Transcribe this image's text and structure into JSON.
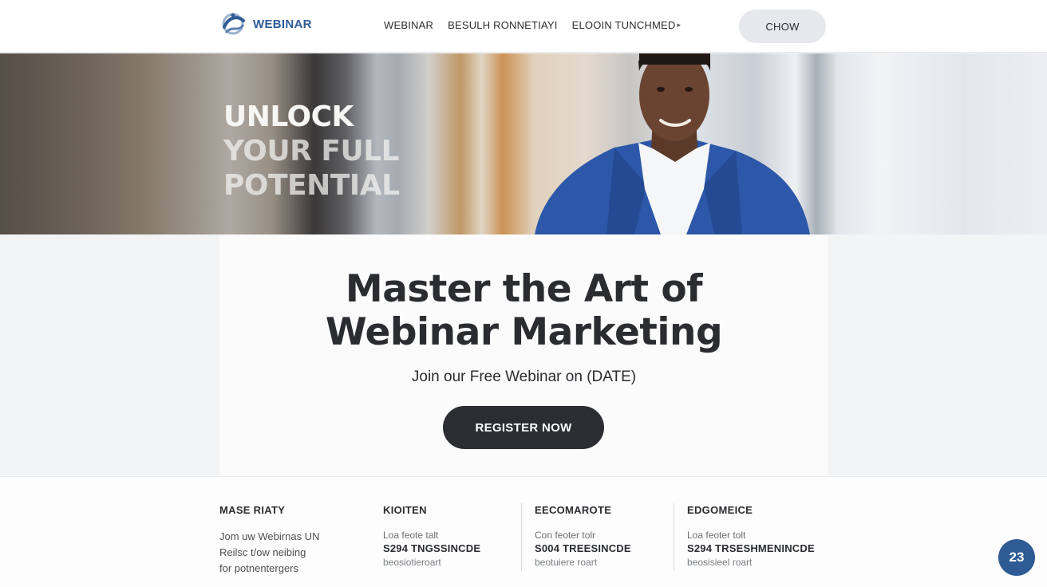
{
  "header": {
    "logo_text": "WEBINAR",
    "nav": [
      {
        "label": "WEBINAR"
      },
      {
        "label": "BESULH RONNETIAYI"
      },
      {
        "label": "ELOOIN TUNCHMED"
      }
    ],
    "cta_label": "CHOW"
  },
  "hero": {
    "title_line1": "UNLOCK",
    "title_line2": "YOUR FULL",
    "title_line3": "POTENTIAL"
  },
  "card": {
    "title_line1": "Master the Art of",
    "title_line2": "Webinar Marketing",
    "subtitle": "Join our Free Webinar on  (DATE)",
    "register_label": "REGISTER NOW"
  },
  "footer": {
    "columns": [
      {
        "heading": "MASE RIATY",
        "lines": [
          "Jom uw Webirnas UN",
          "Reilsc t/ow neibing",
          "for potnentergers"
        ]
      },
      {
        "heading": "KIOITEN",
        "small": "Loa feote talt",
        "strong": "S294 TNGSSINCDE",
        "muted": "beosiotieroart"
      },
      {
        "heading": "EECOMAROTE",
        "small": "Con feoter tolr",
        "strong": "S004 TREESINCDE",
        "muted": "beotuiere roart"
      },
      {
        "heading": "EDGOMEICE",
        "small": "Loa feoter tolt",
        "strong": "S294 TRSESHMENINCDE",
        "muted": "beosisieel roart"
      }
    ]
  },
  "page_number": "23",
  "colors": {
    "brand": "#2f5b95",
    "dark_button": "#2b2d30"
  }
}
